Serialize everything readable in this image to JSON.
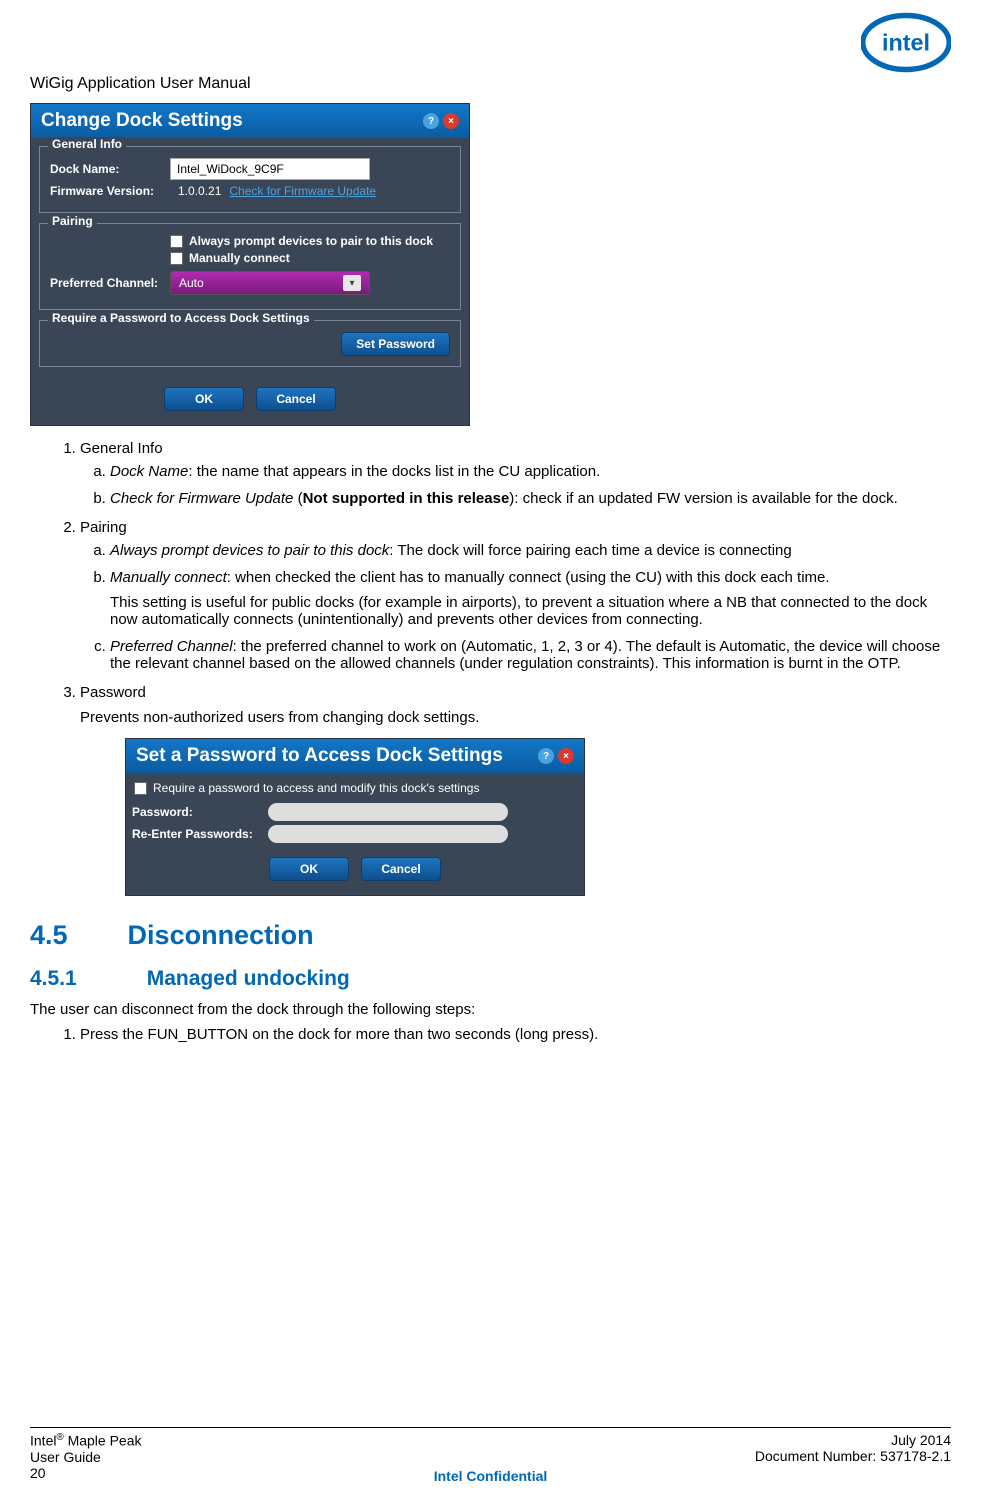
{
  "header": {
    "title": "WiGig Application User Manual"
  },
  "dialog1": {
    "title": "Change Dock Settings",
    "general_info": {
      "legend": "General Info",
      "dock_name_label": "Dock Name:",
      "dock_name_value": "Intel_WiDock_9C9F",
      "firmware_label": "Firmware Version:",
      "firmware_value": "1.0.0.21",
      "firmware_link": "Check for Firmware Update"
    },
    "pairing": {
      "legend": "Pairing",
      "opt1": "Always prompt devices to pair to this dock",
      "opt2": "Manually connect",
      "channel_label": "Preferred Channel:",
      "channel_value": "Auto"
    },
    "password_section": {
      "legend": "Require a Password to Access Dock Settings",
      "set_password_btn": "Set Password"
    },
    "ok_btn": "OK",
    "cancel_btn": "Cancel"
  },
  "list": {
    "item1": {
      "title": "General Info",
      "a_term": "Dock Name",
      "a_rest": ": the name that appears in the docks list in the CU application.",
      "b_term": "Check for Firmware Update",
      "b_mid": " (",
      "b_bold": "Not supported in this release",
      "b_rest": "): check if an updated FW version is available for the dock."
    },
    "item2": {
      "title": "Pairing",
      "a_term": "Always prompt devices to pair to this dock",
      "a_rest": ": The dock will force pairing each time a device is connecting",
      "b_term": "Manually connect",
      "b_rest": ": when checked the client has to manually connect (using the CU) with this dock each time.",
      "b_para": "This setting is useful for public docks (for example in airports), to prevent a situation where a NB that connected to the dock now automatically connects (unintentionally) and prevents other devices from connecting.",
      "c_term": "Preferred Channel",
      "c_rest": ": the preferred channel to work on (Automatic, 1, 2, 3 or 4). The default is Automatic, the device will choose the relevant channel based on the allowed channels (under regulation constraints). This information is burnt in the OTP."
    },
    "item3": {
      "title": "Password",
      "para": "Prevents non-authorized users from changing dock settings."
    }
  },
  "dialog2": {
    "title": "Set a Password to Access Dock Settings",
    "chk_label": "Require a password to access and modify this dock's settings",
    "pw_label": "Password:",
    "repw_label": "Re-Enter Passwords:",
    "ok_btn": "OK",
    "cancel_btn": "Cancel"
  },
  "h2": {
    "num": "4.5",
    "text": "Disconnection"
  },
  "h3": {
    "num": "4.5.1",
    "text": "Managed undocking"
  },
  "body_after_h3": {
    "intro": "The user can disconnect from the dock through the following steps:",
    "step1": "Press the FUN_BUTTON on the dock for more than two seconds (long press)."
  },
  "footer": {
    "left_line1_pre": "Intel",
    "left_line1_post": " Maple Peak",
    "left_line2": "User Guide",
    "left_line3": "20",
    "center": "Intel Confidential",
    "right_line1": "July 2014",
    "right_line2": "Document Number: 537178-2.1"
  }
}
